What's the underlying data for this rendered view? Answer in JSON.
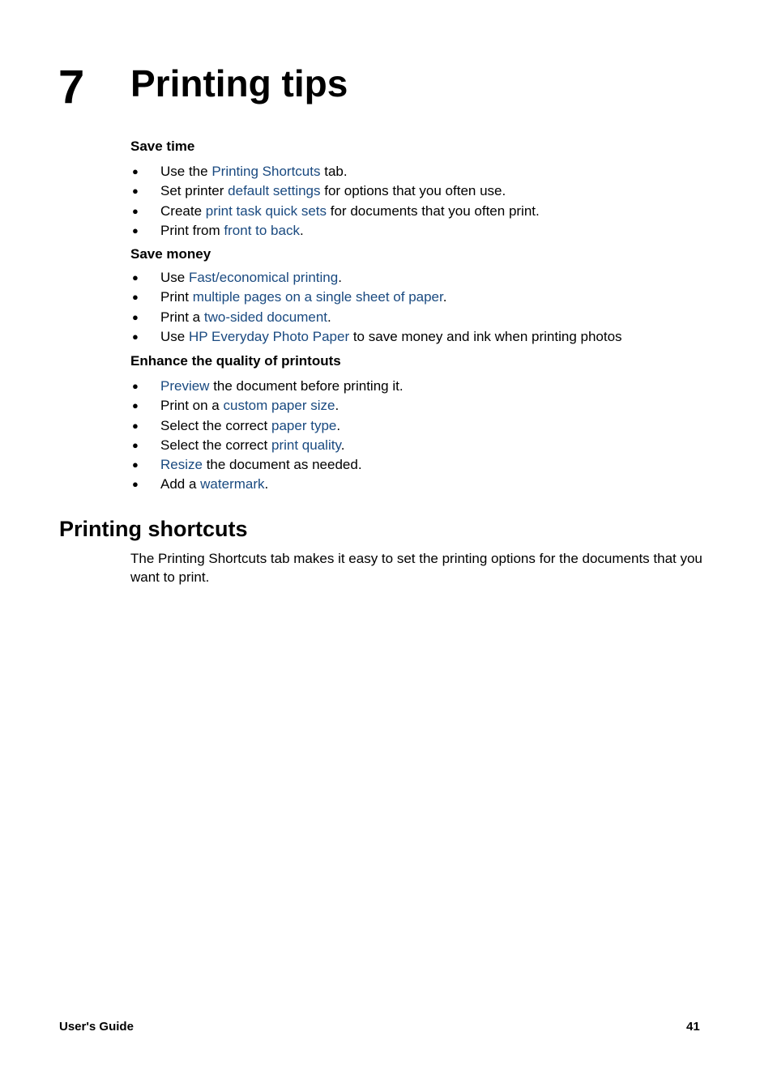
{
  "chapter": {
    "number": "7",
    "title": "Printing tips"
  },
  "sections": [
    {
      "heading": "Save time",
      "items": [
        [
          {
            "t": "Use the "
          },
          {
            "t": "Printing Shortcuts",
            "link": true
          },
          {
            "t": " tab."
          }
        ],
        [
          {
            "t": "Set printer "
          },
          {
            "t": "default settings",
            "link": true
          },
          {
            "t": " for options that you often use."
          }
        ],
        [
          {
            "t": "Create "
          },
          {
            "t": "print task quick sets",
            "link": true
          },
          {
            "t": " for documents that you often print."
          }
        ],
        [
          {
            "t": "Print from "
          },
          {
            "t": "front to back",
            "link": true
          },
          {
            "t": "."
          }
        ]
      ]
    },
    {
      "heading": "Save money",
      "items": [
        [
          {
            "t": "Use "
          },
          {
            "t": "Fast/economical printing",
            "link": true
          },
          {
            "t": "."
          }
        ],
        [
          {
            "t": "Print "
          },
          {
            "t": "multiple pages on a single sheet of paper",
            "link": true
          },
          {
            "t": "."
          }
        ],
        [
          {
            "t": "Print a "
          },
          {
            "t": "two-sided document",
            "link": true
          },
          {
            "t": "."
          }
        ],
        [
          {
            "t": "Use "
          },
          {
            "t": "HP Everyday Photo Paper",
            "link": true
          },
          {
            "t": " to save money and ink when printing photos"
          }
        ]
      ]
    },
    {
      "heading": "Enhance the quality of printouts",
      "items": [
        [
          {
            "t": "Preview",
            "link": true
          },
          {
            "t": " the document before printing it."
          }
        ],
        [
          {
            "t": "Print on a "
          },
          {
            "t": "custom paper size",
            "link": true
          },
          {
            "t": "."
          }
        ],
        [
          {
            "t": "Select the correct "
          },
          {
            "t": "paper type",
            "link": true
          },
          {
            "t": "."
          }
        ],
        [
          {
            "t": "Select the correct "
          },
          {
            "t": "print quality",
            "link": true
          },
          {
            "t": "."
          }
        ],
        [
          {
            "t": "Resize",
            "link": true
          },
          {
            "t": " the document as needed."
          }
        ],
        [
          {
            "t": "Add a "
          },
          {
            "t": "watermark",
            "link": true
          },
          {
            "t": "."
          }
        ]
      ]
    }
  ],
  "bullet_glyph": "●",
  "shortcuts_section": {
    "heading": "Printing shortcuts",
    "paragraph": "The Printing Shortcuts tab makes it easy to set the printing options for the documents that you want to print."
  },
  "footer": {
    "left": "User's Guide",
    "page_number": "41"
  },
  "colors": {
    "link": "#1a4a80",
    "text": "#000000"
  }
}
